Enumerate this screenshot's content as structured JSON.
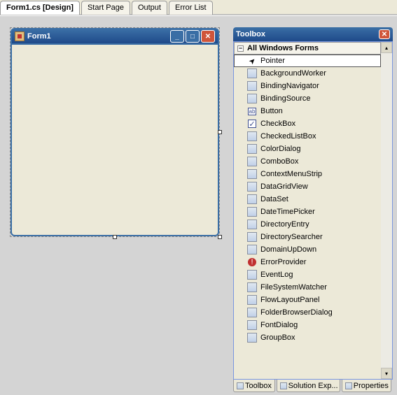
{
  "doc_tabs": [
    {
      "label": "Form1.cs [Design]",
      "active": true
    },
    {
      "label": "Start Page",
      "active": false
    },
    {
      "label": "Output",
      "active": false
    },
    {
      "label": "Error List",
      "active": false
    }
  ],
  "form": {
    "title": "Form1"
  },
  "toolbox": {
    "title": "Toolbox",
    "category": "All Windows Forms",
    "items": [
      {
        "label": "Pointer",
        "icon": "pointer-icon",
        "glyph": "➤",
        "selected": true
      },
      {
        "label": "BackgroundWorker",
        "icon": "backgroundworker-icon",
        "glyph": "◧"
      },
      {
        "label": "BindingNavigator",
        "icon": "bindingnavigator-icon",
        "glyph": "▭"
      },
      {
        "label": "BindingSource",
        "icon": "bindingsource-icon",
        "glyph": "◫"
      },
      {
        "label": "Button",
        "icon": "button-icon",
        "glyph": "ab"
      },
      {
        "label": "CheckBox",
        "icon": "checkbox-icon",
        "glyph": "✓"
      },
      {
        "label": "CheckedListBox",
        "icon": "checkedlistbox-icon",
        "glyph": "☰"
      },
      {
        "label": "ColorDialog",
        "icon": "colordialog-icon",
        "glyph": "▭"
      },
      {
        "label": "ComboBox",
        "icon": "combobox-icon",
        "glyph": "▭"
      },
      {
        "label": "ContextMenuStrip",
        "icon": "contextmenustrip-icon",
        "glyph": "▤"
      },
      {
        "label": "DataGridView",
        "icon": "datagridview-icon",
        "glyph": "▦"
      },
      {
        "label": "DataSet",
        "icon": "dataset-icon",
        "glyph": "▭"
      },
      {
        "label": "DateTimePicker",
        "icon": "datetimepicker-icon",
        "glyph": "▭"
      },
      {
        "label": "DirectoryEntry",
        "icon": "directoryentry-icon",
        "glyph": "◆"
      },
      {
        "label": "DirectorySearcher",
        "icon": "directorysearcher-icon",
        "glyph": "◇"
      },
      {
        "label": "DomainUpDown",
        "icon": "domainupdown-icon",
        "glyph": "▭"
      },
      {
        "label": "ErrorProvider",
        "icon": "errorprovider-icon",
        "glyph": "!"
      },
      {
        "label": "EventLog",
        "icon": "eventlog-icon",
        "glyph": "▭"
      },
      {
        "label": "FileSystemWatcher",
        "icon": "filesystemwatcher-icon",
        "glyph": "◐"
      },
      {
        "label": "FlowLayoutPanel",
        "icon": "flowlayoutpanel-icon",
        "glyph": "▭"
      },
      {
        "label": "FolderBrowserDialog",
        "icon": "folderbrowserdialog-icon",
        "glyph": "▭"
      },
      {
        "label": "FontDialog",
        "icon": "fontdialog-icon",
        "glyph": "▭"
      },
      {
        "label": "GroupBox",
        "icon": "groupbox-icon",
        "glyph": "▭"
      }
    ]
  },
  "bottom_tabs": [
    {
      "label": "Toolbox",
      "icon": "toolbox-icon"
    },
    {
      "label": "Solution Exp...",
      "icon": "solution-explorer-icon"
    },
    {
      "label": "Properties",
      "icon": "properties-icon"
    }
  ]
}
